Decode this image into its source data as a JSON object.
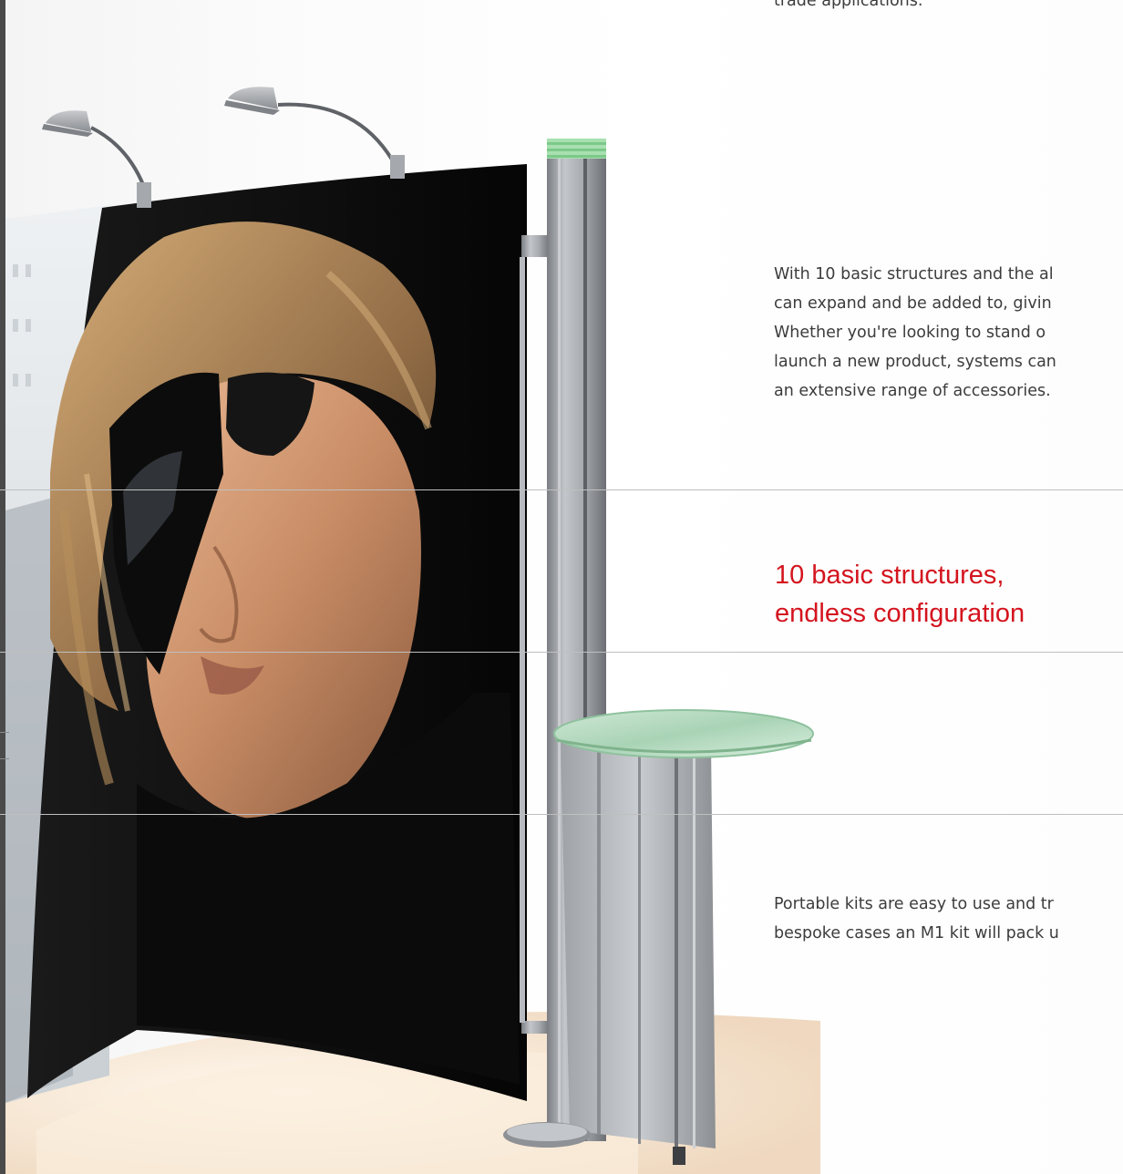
{
  "copy": {
    "top_fragment": "trade applications.",
    "intro_lines": [
      "With 10 basic structures and the al",
      "can expand and be added to, givin",
      "Whether you're looking to stand o",
      "launch a new product, systems can",
      "an extensive range of accessories."
    ],
    "heading_lines": [
      "10 basic structures,",
      "endless configuration"
    ],
    "portable_lines": [
      "Portable kits are easy to use and tr",
      "bespoke cases an M1 kit will pack u"
    ]
  },
  "colors": {
    "heading": "#d4141e",
    "body_text": "#3c3c3c",
    "rule": "#bfbfbf"
  }
}
